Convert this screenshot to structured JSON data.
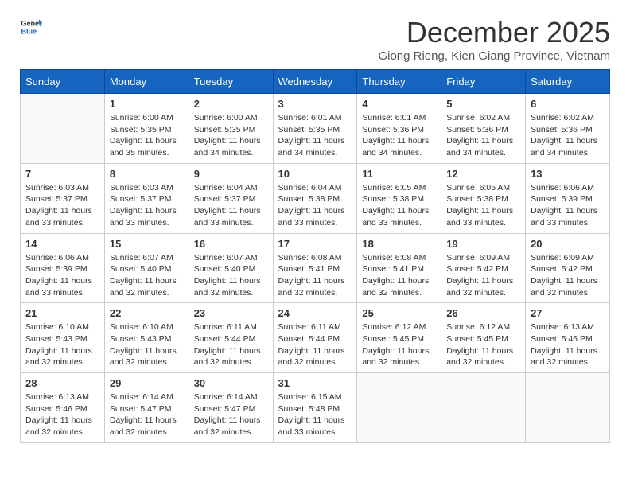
{
  "header": {
    "logo_line1": "General",
    "logo_line2": "Blue",
    "month": "December 2025",
    "location": "Giong Rieng, Kien Giang Province, Vietnam"
  },
  "days_of_week": [
    "Sunday",
    "Monday",
    "Tuesday",
    "Wednesday",
    "Thursday",
    "Friday",
    "Saturday"
  ],
  "weeks": [
    [
      {
        "day": null,
        "info": null
      },
      {
        "day": "1",
        "sunrise": "Sunrise: 6:00 AM",
        "sunset": "Sunset: 5:35 PM",
        "daylight": "Daylight: 11 hours and 35 minutes."
      },
      {
        "day": "2",
        "sunrise": "Sunrise: 6:00 AM",
        "sunset": "Sunset: 5:35 PM",
        "daylight": "Daylight: 11 hours and 34 minutes."
      },
      {
        "day": "3",
        "sunrise": "Sunrise: 6:01 AM",
        "sunset": "Sunset: 5:35 PM",
        "daylight": "Daylight: 11 hours and 34 minutes."
      },
      {
        "day": "4",
        "sunrise": "Sunrise: 6:01 AM",
        "sunset": "Sunset: 5:36 PM",
        "daylight": "Daylight: 11 hours and 34 minutes."
      },
      {
        "day": "5",
        "sunrise": "Sunrise: 6:02 AM",
        "sunset": "Sunset: 5:36 PM",
        "daylight": "Daylight: 11 hours and 34 minutes."
      },
      {
        "day": "6",
        "sunrise": "Sunrise: 6:02 AM",
        "sunset": "Sunset: 5:36 PM",
        "daylight": "Daylight: 11 hours and 34 minutes."
      }
    ],
    [
      {
        "day": "7",
        "sunrise": "Sunrise: 6:03 AM",
        "sunset": "Sunset: 5:37 PM",
        "daylight": "Daylight: 11 hours and 33 minutes."
      },
      {
        "day": "8",
        "sunrise": "Sunrise: 6:03 AM",
        "sunset": "Sunset: 5:37 PM",
        "daylight": "Daylight: 11 hours and 33 minutes."
      },
      {
        "day": "9",
        "sunrise": "Sunrise: 6:04 AM",
        "sunset": "Sunset: 5:37 PM",
        "daylight": "Daylight: 11 hours and 33 minutes."
      },
      {
        "day": "10",
        "sunrise": "Sunrise: 6:04 AM",
        "sunset": "Sunset: 5:38 PM",
        "daylight": "Daylight: 11 hours and 33 minutes."
      },
      {
        "day": "11",
        "sunrise": "Sunrise: 6:05 AM",
        "sunset": "Sunset: 5:38 PM",
        "daylight": "Daylight: 11 hours and 33 minutes."
      },
      {
        "day": "12",
        "sunrise": "Sunrise: 6:05 AM",
        "sunset": "Sunset: 5:38 PM",
        "daylight": "Daylight: 11 hours and 33 minutes."
      },
      {
        "day": "13",
        "sunrise": "Sunrise: 6:06 AM",
        "sunset": "Sunset: 5:39 PM",
        "daylight": "Daylight: 11 hours and 33 minutes."
      }
    ],
    [
      {
        "day": "14",
        "sunrise": "Sunrise: 6:06 AM",
        "sunset": "Sunset: 5:39 PM",
        "daylight": "Daylight: 11 hours and 33 minutes."
      },
      {
        "day": "15",
        "sunrise": "Sunrise: 6:07 AM",
        "sunset": "Sunset: 5:40 PM",
        "daylight": "Daylight: 11 hours and 32 minutes."
      },
      {
        "day": "16",
        "sunrise": "Sunrise: 6:07 AM",
        "sunset": "Sunset: 5:40 PM",
        "daylight": "Daylight: 11 hours and 32 minutes."
      },
      {
        "day": "17",
        "sunrise": "Sunrise: 6:08 AM",
        "sunset": "Sunset: 5:41 PM",
        "daylight": "Daylight: 11 hours and 32 minutes."
      },
      {
        "day": "18",
        "sunrise": "Sunrise: 6:08 AM",
        "sunset": "Sunset: 5:41 PM",
        "daylight": "Daylight: 11 hours and 32 minutes."
      },
      {
        "day": "19",
        "sunrise": "Sunrise: 6:09 AM",
        "sunset": "Sunset: 5:42 PM",
        "daylight": "Daylight: 11 hours and 32 minutes."
      },
      {
        "day": "20",
        "sunrise": "Sunrise: 6:09 AM",
        "sunset": "Sunset: 5:42 PM",
        "daylight": "Daylight: 11 hours and 32 minutes."
      }
    ],
    [
      {
        "day": "21",
        "sunrise": "Sunrise: 6:10 AM",
        "sunset": "Sunset: 5:43 PM",
        "daylight": "Daylight: 11 hours and 32 minutes."
      },
      {
        "day": "22",
        "sunrise": "Sunrise: 6:10 AM",
        "sunset": "Sunset: 5:43 PM",
        "daylight": "Daylight: 11 hours and 32 minutes."
      },
      {
        "day": "23",
        "sunrise": "Sunrise: 6:11 AM",
        "sunset": "Sunset: 5:44 PM",
        "daylight": "Daylight: 11 hours and 32 minutes."
      },
      {
        "day": "24",
        "sunrise": "Sunrise: 6:11 AM",
        "sunset": "Sunset: 5:44 PM",
        "daylight": "Daylight: 11 hours and 32 minutes."
      },
      {
        "day": "25",
        "sunrise": "Sunrise: 6:12 AM",
        "sunset": "Sunset: 5:45 PM",
        "daylight": "Daylight: 11 hours and 32 minutes."
      },
      {
        "day": "26",
        "sunrise": "Sunrise: 6:12 AM",
        "sunset": "Sunset: 5:45 PM",
        "daylight": "Daylight: 11 hours and 32 minutes."
      },
      {
        "day": "27",
        "sunrise": "Sunrise: 6:13 AM",
        "sunset": "Sunset: 5:46 PM",
        "daylight": "Daylight: 11 hours and 32 minutes."
      }
    ],
    [
      {
        "day": "28",
        "sunrise": "Sunrise: 6:13 AM",
        "sunset": "Sunset: 5:46 PM",
        "daylight": "Daylight: 11 hours and 32 minutes."
      },
      {
        "day": "29",
        "sunrise": "Sunrise: 6:14 AM",
        "sunset": "Sunset: 5:47 PM",
        "daylight": "Daylight: 11 hours and 32 minutes."
      },
      {
        "day": "30",
        "sunrise": "Sunrise: 6:14 AM",
        "sunset": "Sunset: 5:47 PM",
        "daylight": "Daylight: 11 hours and 32 minutes."
      },
      {
        "day": "31",
        "sunrise": "Sunrise: 6:15 AM",
        "sunset": "Sunset: 5:48 PM",
        "daylight": "Daylight: 11 hours and 33 minutes."
      },
      {
        "day": null,
        "info": null
      },
      {
        "day": null,
        "info": null
      },
      {
        "day": null,
        "info": null
      }
    ]
  ]
}
